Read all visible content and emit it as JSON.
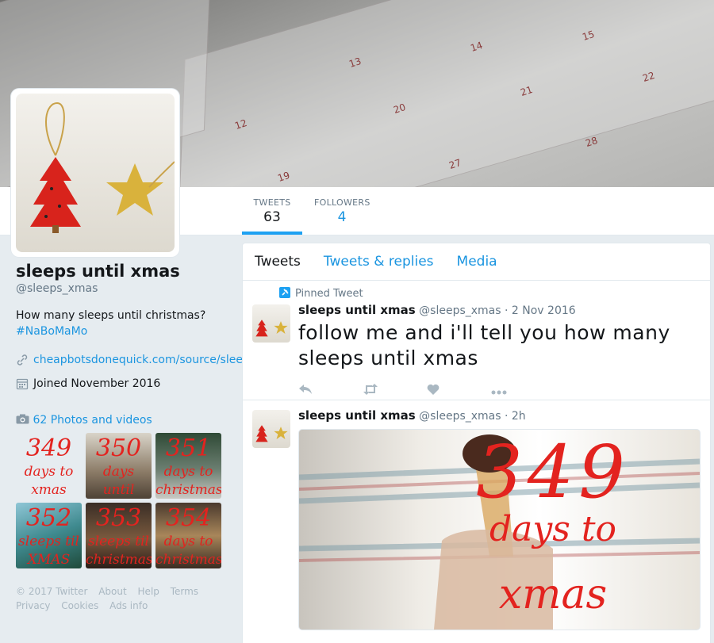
{
  "profile": {
    "name": "sleeps until xmas",
    "handle": "@sleeps_xmas",
    "bio": "How many sleeps until christmas?",
    "hashtag": "#NaBoMaMo",
    "url": "cheapbotsdonequick.com/source/sleeps_...",
    "joined": "Joined November 2016",
    "link_icon": "link-icon",
    "calendar_icon": "calendar-icon"
  },
  "stats": {
    "tweets_label": "TWEETS",
    "tweets_value": "63",
    "followers_label": "FOLLOWERS",
    "followers_value": "4"
  },
  "photos": {
    "header": "62 Photos and videos",
    "icon": "camera-icon",
    "items": [
      {
        "number": "349",
        "caption_1": "days to",
        "caption_2": "xmas"
      },
      {
        "number": "350",
        "caption_1": "days until",
        "caption_2": "christmas"
      },
      {
        "number": "351",
        "caption_1": "days to",
        "caption_2": "christmas"
      },
      {
        "number": "352",
        "caption_1": "sleeps til",
        "caption_2": "XMAS"
      },
      {
        "number": "353",
        "caption_1": "sleeps til",
        "caption_2": "christmas"
      },
      {
        "number": "354",
        "caption_1": "days to",
        "caption_2": "christmas"
      }
    ]
  },
  "footer": {
    "copyright": "© 2017 Twitter",
    "about": "About",
    "help": "Help",
    "terms": "Terms",
    "privacy": "Privacy",
    "cookies": "Cookies",
    "ads": "Ads info"
  },
  "timeline": {
    "tabs": [
      "Tweets",
      "Tweets & replies",
      "Media"
    ],
    "tweets": [
      {
        "pinned_label": "Pinned Tweet",
        "name": "sleeps until xmas",
        "handle": "@sleeps_xmas",
        "time": "· 2 Nov 2016",
        "text": "follow me and i'll tell you how many sleeps until xmas"
      },
      {
        "name": "sleeps until xmas",
        "handle": "@sleeps_xmas",
        "time": "· 2h",
        "media_number": "349",
        "media_line1": "days to",
        "media_line2": "xmas"
      }
    ]
  },
  "banner_numbers": [
    "13",
    "14",
    "15",
    "20",
    "21",
    "22",
    "27",
    "28",
    "12",
    "19"
  ],
  "colors": {
    "accent": "#1da1f2",
    "link": "#1b95e0",
    "overlay_text": "#e3231f"
  }
}
